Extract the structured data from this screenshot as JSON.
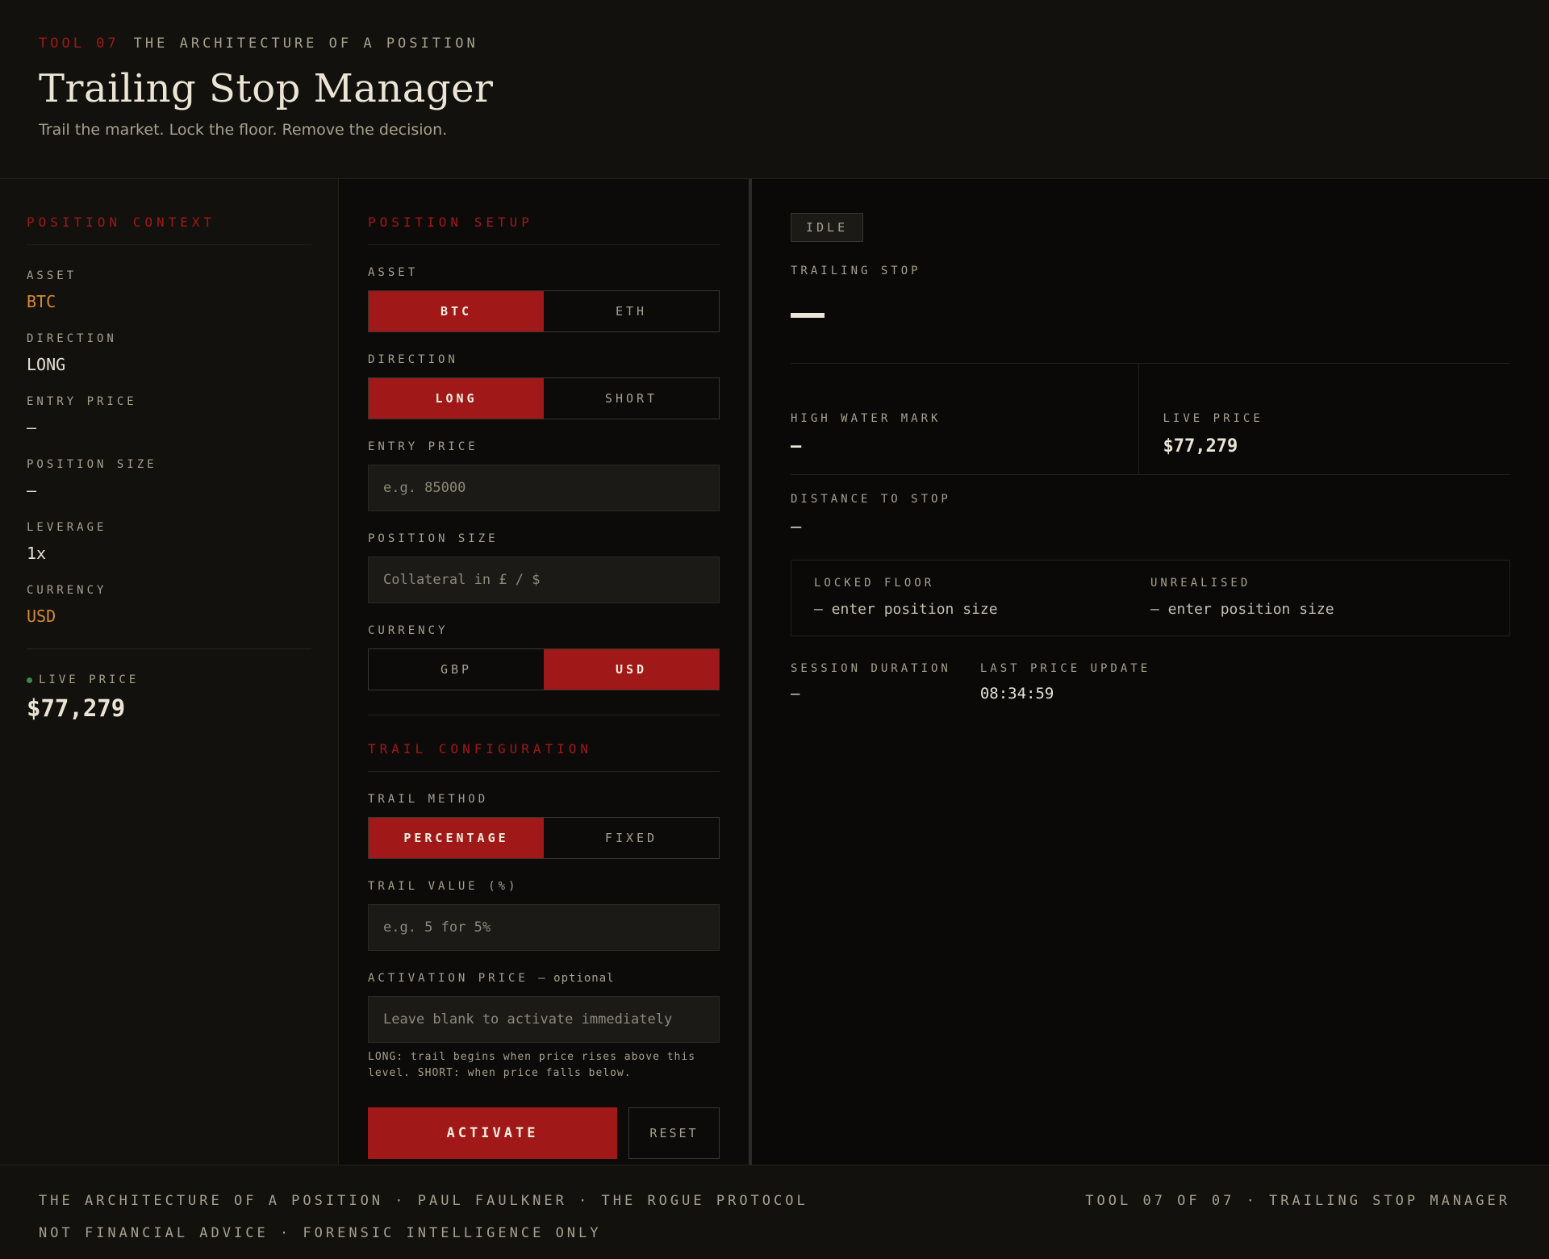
{
  "header": {
    "tool_tag": "TOOL 07",
    "kicker": "THE ARCHITECTURE OF A POSITION",
    "title": "Trailing Stop Manager",
    "tagline": "Trail the market. Lock the floor. Remove the decision."
  },
  "context": {
    "heading": "POSITION CONTEXT",
    "items": [
      {
        "label": "ASSET",
        "value": "BTC"
      },
      {
        "label": "DIRECTION",
        "value": "LONG"
      },
      {
        "label": "ENTRY PRICE",
        "value": "—"
      },
      {
        "label": "POSITION SIZE",
        "value": "—"
      },
      {
        "label": "LEVERAGE",
        "value": "1x"
      },
      {
        "label": "CURRENCY",
        "value": "USD"
      }
    ],
    "live_label": "LIVE PRICE",
    "live_value": "$77,279"
  },
  "setup": {
    "heading": "POSITION SETUP",
    "asset_label": "ASSET",
    "asset_options": [
      "BTC",
      "ETH"
    ],
    "direction_label": "DIRECTION",
    "direction_options": [
      "LONG",
      "SHORT"
    ],
    "entry_label": "ENTRY PRICE",
    "entry_placeholder": "e.g. 85000",
    "size_label": "POSITION SIZE",
    "size_placeholder": "Collateral in £ / $",
    "currency_label": "CURRENCY",
    "currency_options": [
      "GBP",
      "USD"
    ]
  },
  "trail": {
    "heading": "TRAIL CONFIGURATION",
    "method_label": "TRAIL METHOD",
    "method_options": [
      "PERCENTAGE",
      "FIXED"
    ],
    "value_label": "TRAIL VALUE (%)",
    "value_placeholder": "e.g. 5 for 5%",
    "activation_label": "ACTIVATION PRICE",
    "activation_optional": "— optional",
    "activation_placeholder": "Leave blank to activate immediately",
    "hint": "LONG: trail begins when price rises above this level. SHORT: when price falls below.",
    "activate_label": "ACTIVATE",
    "reset_label": "RESET"
  },
  "results": {
    "status": "IDLE",
    "stop_label": "TRAILING STOP",
    "hwm_label": "HIGH WATER MARK",
    "hwm_value": "—",
    "live_label": "LIVE PRICE",
    "live_value": "$77,279",
    "distance_label": "DISTANCE TO STOP",
    "distance_value": "—",
    "floor_label": "LOCKED FLOOR",
    "floor_value": "— enter position size",
    "unrealised_label": "UNREALISED",
    "unrealised_value": "— enter position size",
    "session_label": "SESSION DURATION",
    "session_value": "—",
    "update_label": "LAST PRICE UPDATE",
    "update_value": "08:34:59"
  },
  "footer": {
    "left1": "THE ARCHITECTURE OF A POSITION · PAUL FAULKNER · THE ROGUE PROTOCOL",
    "right1": "TOOL 07 OF 07 · TRAILING STOP MANAGER",
    "left2": "NOT FINANCIAL ADVICE · FORENSIC INTELLIGENCE ONLY"
  },
  "colors": {
    "accent_red": "#a01818",
    "accent_orange": "#d88a2a",
    "live_dot": "#3d8a4a",
    "background": "#0a0908"
  }
}
